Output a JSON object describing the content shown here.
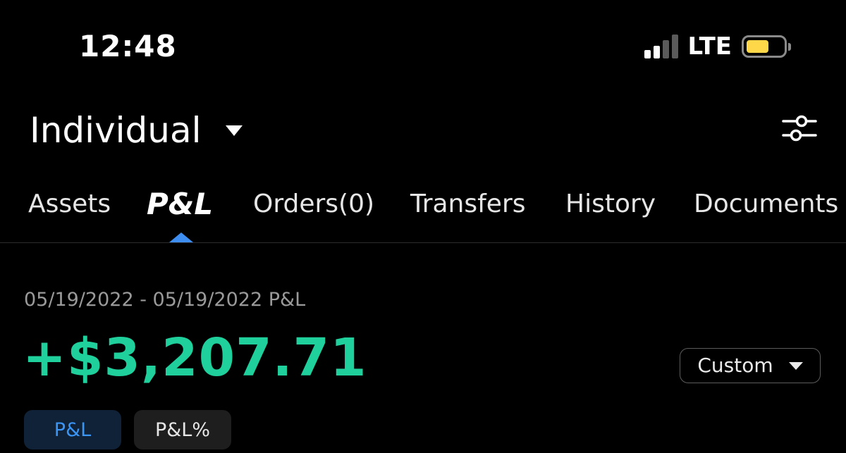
{
  "status_bar": {
    "time": "12:48",
    "network": "LTE",
    "signal_bars_filled": 2,
    "signal_bars_total": 4,
    "battery_level": 0.55,
    "battery_color": "#ffd84a"
  },
  "header": {
    "account_name": "Individual",
    "account_dropdown_icon": "caret-down-icon",
    "filter_icon": "sliders-icon"
  },
  "tabs": [
    {
      "label": "Assets",
      "active": false
    },
    {
      "label": "P&L",
      "active": true
    },
    {
      "label": "Orders(0)",
      "active": false
    },
    {
      "label": "Transfers",
      "active": false
    },
    {
      "label": "History",
      "active": false
    },
    {
      "label": "Documents",
      "active": false
    }
  ],
  "pnl": {
    "date_range": "05/19/2022 - 05/19/2022 P&L",
    "value": "+$3,207.71",
    "value_color": "#1fcf9c",
    "range_selector": "Custom",
    "toggles": [
      {
        "label": "P&L",
        "selected": true
      },
      {
        "label": "P&L%",
        "selected": false
      }
    ]
  },
  "colors": {
    "background": "#000000",
    "accent": "#3d8ef0",
    "positive": "#1fcf9c"
  }
}
